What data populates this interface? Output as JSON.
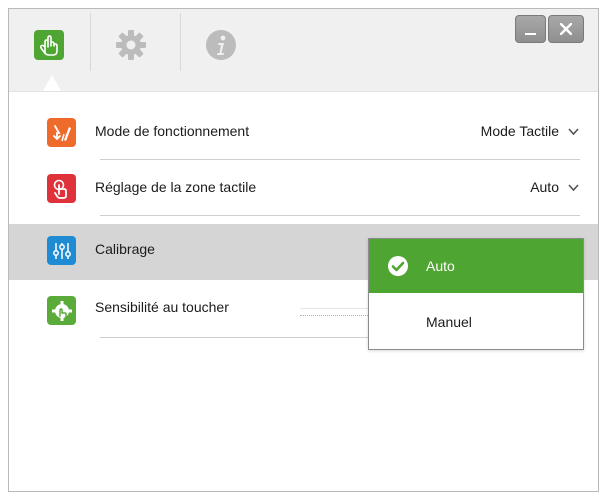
{
  "window": {
    "tabs": [
      {
        "icon": "touch-hand-icon",
        "active": true
      },
      {
        "icon": "gear-icon",
        "active": false
      },
      {
        "icon": "info-icon",
        "active": false
      }
    ],
    "controls": {
      "minimize": "minimize-icon",
      "close": "close-icon"
    }
  },
  "colors": {
    "accent_green": "#4fa531",
    "icon_orange": "#ef6b2c",
    "icon_red": "#e0323b",
    "icon_blue": "#1e8bd2",
    "icon_green": "#5aab3a",
    "highlight_row": "#d5d5d5"
  },
  "rows": [
    {
      "label": "Mode de fonctionnement",
      "value": "Mode Tactile",
      "icon": "mode-pen-icon"
    },
    {
      "label": "Réglage de la zone tactile",
      "value": "Auto",
      "icon": "touch-zone-icon"
    },
    {
      "label": "Calibrage",
      "value": "",
      "icon": "sliders-icon"
    },
    {
      "label": "Sensibilité au toucher",
      "value": "",
      "icon": "sensitivity-icon"
    }
  ],
  "popup": {
    "options": [
      {
        "label": "Auto",
        "selected": true
      },
      {
        "label": "Manuel",
        "selected": false
      }
    ]
  }
}
